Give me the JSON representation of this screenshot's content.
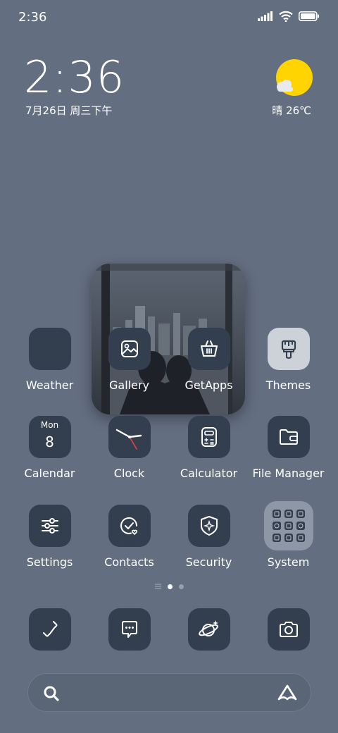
{
  "status_bar": {
    "time": "2:36",
    "icons": [
      "signal-icon",
      "wifi-icon",
      "battery-icon"
    ]
  },
  "clock_widget": {
    "time": "2:36",
    "date": "7月26日 周三下午",
    "weather": "晴 26℃",
    "weather_icon": "sun-cloud-icon"
  },
  "apps": [
    {
      "label": "Weather"
    },
    {
      "label": "Gallery"
    },
    {
      "label": "GetApps"
    },
    {
      "label": "Themes"
    },
    {
      "label": "Calendar",
      "day": "Mon",
      "date": "8"
    },
    {
      "label": "Clock"
    },
    {
      "label": "Calculator"
    },
    {
      "label": "File Manager"
    },
    {
      "label": "Settings"
    },
    {
      "label": "Contacts"
    },
    {
      "label": "Security"
    },
    {
      "label": "System"
    }
  ],
  "dock": [
    {
      "icon": "phone-icon"
    },
    {
      "icon": "messages-icon"
    },
    {
      "icon": "browser-icon"
    },
    {
      "icon": "camera-icon"
    }
  ],
  "colors": {
    "background": "#636e80",
    "icon_bg": "#333e4f",
    "sun": "#ffd400"
  }
}
